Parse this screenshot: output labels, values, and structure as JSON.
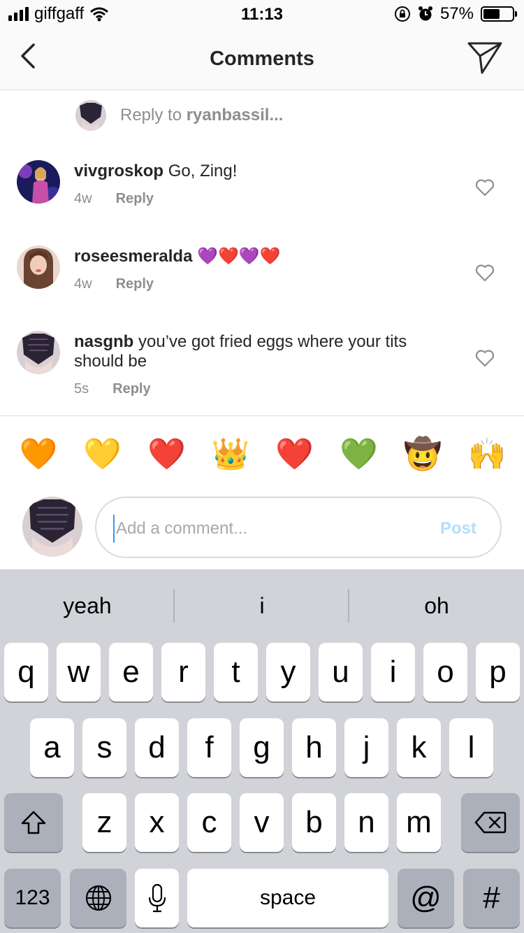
{
  "status_bar": {
    "carrier": "giffgaff",
    "time": "11:13",
    "battery": "57%",
    "battery_level": 0.57
  },
  "header": {
    "title": "Comments"
  },
  "reply_target": {
    "prefix": "Reply to ",
    "username": "ryanbassil..."
  },
  "comments": [
    {
      "username": "vivgroskop",
      "text": " Go, Zing!",
      "age": "4w",
      "reply_label": "Reply"
    },
    {
      "username": "roseesmeralda",
      "text": " 💜❤️💜❤️",
      "age": "4w",
      "reply_label": "Reply"
    },
    {
      "username": "nasgnb",
      "text": " you’ve got fried eggs where your tits should be",
      "age": "5s",
      "reply_label": "Reply"
    }
  ],
  "quick_emojis": [
    "🧡",
    "💛",
    "❤️",
    "👑",
    "❤️",
    "💚",
    "🤠",
    "🙌"
  ],
  "composer": {
    "placeholder": "Add a comment...",
    "post_label": "Post"
  },
  "keyboard": {
    "predictions": [
      "yeah",
      "i",
      "oh"
    ],
    "row1": [
      "q",
      "w",
      "e",
      "r",
      "t",
      "y",
      "u",
      "i",
      "o",
      "p"
    ],
    "row2": [
      "a",
      "s",
      "d",
      "f",
      "g",
      "h",
      "j",
      "k",
      "l"
    ],
    "row3": [
      "z",
      "x",
      "c",
      "v",
      "b",
      "n",
      "m"
    ],
    "numbers_label": "123",
    "space_label": "space",
    "at_label": "@",
    "hash_label": "#"
  }
}
